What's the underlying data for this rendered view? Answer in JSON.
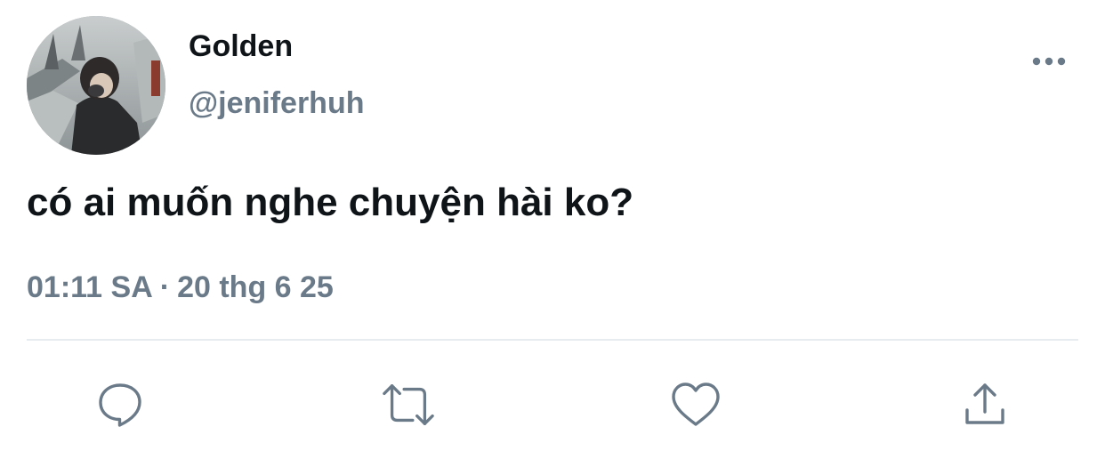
{
  "author": {
    "display_name": "Golden",
    "handle": "@jeniferhuh"
  },
  "tweet": {
    "text": "có ai muốn nghe chuyện hài ko?",
    "time": "01:11 SA",
    "separator": "·",
    "date": "20 thg 6 25"
  },
  "icons": {
    "more": "more-horizontal-icon",
    "reply": "reply-bubble-icon",
    "retweet": "retweet-icon",
    "like": "heart-icon",
    "share": "share-upload-icon"
  },
  "colors": {
    "text_primary": "#0f1419",
    "text_secondary": "#6b7a88",
    "icon": "#6b7a88",
    "divider": "#e6ecf0"
  }
}
